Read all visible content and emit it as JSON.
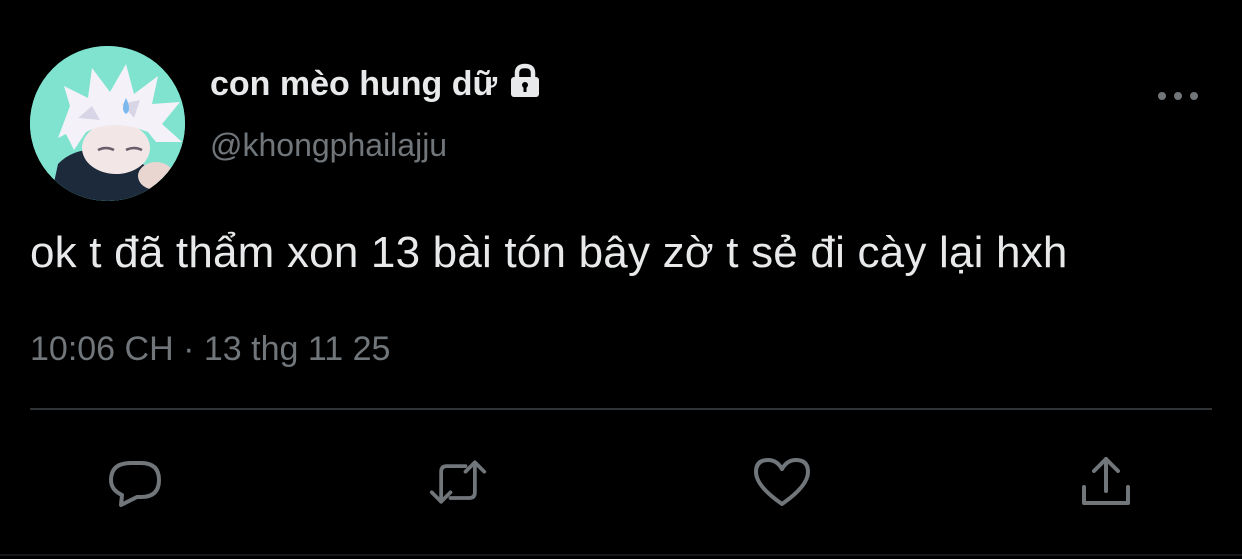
{
  "user": {
    "display_name": "con mèo hung dữ",
    "handle": "@khongphailajju",
    "protected_icon": "lock-icon",
    "avatar_icon": "anime-avatar"
  },
  "tweet": {
    "text": "ok t đã thẩm xon 13 bài tón bây zờ t sẻ đi cày lại hxh",
    "timestamp": "10:06 CH · 13 thg 11 25"
  },
  "actions": [
    {
      "name": "reply",
      "icon": "speech-bubble-icon"
    },
    {
      "name": "retweet",
      "icon": "retweet-arrows-icon"
    },
    {
      "name": "like",
      "icon": "heart-icon"
    },
    {
      "name": "share",
      "icon": "share-upload-icon"
    }
  ],
  "menu": {
    "icon": "more-dots-icon"
  },
  "colors": {
    "background": "#000000",
    "primary_text": "#e7e9ea",
    "secondary_text": "#71767b",
    "divider": "#2f3336"
  }
}
